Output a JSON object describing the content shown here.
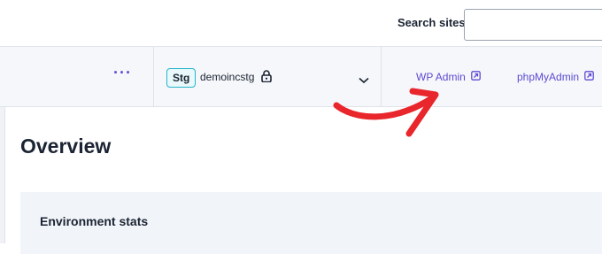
{
  "search": {
    "label": "Search sites",
    "value": "",
    "placeholder": ""
  },
  "env_bar": {
    "more_label": "···",
    "environment": {
      "badge": "Stg",
      "name": "demoincstg"
    },
    "links": [
      {
        "label": "WP Admin",
        "icon": "external-link-icon"
      },
      {
        "label": "phpMyAdmin",
        "icon": "external-link-icon"
      }
    ]
  },
  "main": {
    "title": "Overview",
    "stats_card": {
      "title": "Environment stats"
    }
  },
  "colors": {
    "accent": "#5b4bd4",
    "badge_border": "#26b5c9",
    "annotation_arrow": "#e8262b",
    "bar_bg": "#f5f7fa",
    "card_bg": "#f1f4f8"
  },
  "annotation": {
    "type": "arrow",
    "points_to": "WP Admin"
  }
}
